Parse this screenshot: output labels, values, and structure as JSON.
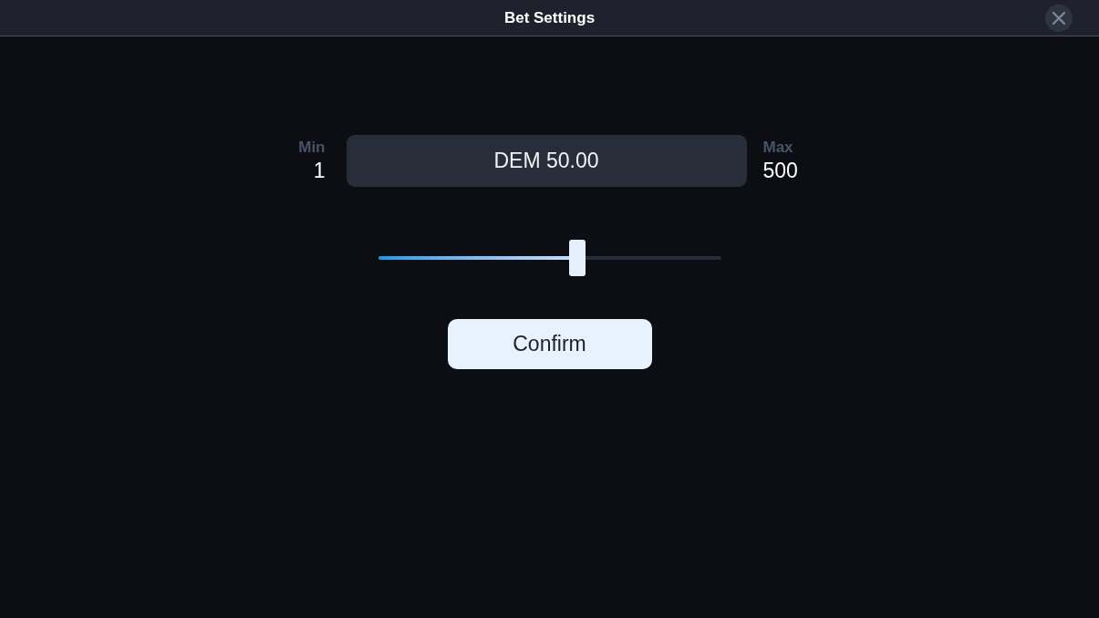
{
  "window": {
    "title": "Bet Settings"
  },
  "bet": {
    "min_label": "Min",
    "min_value": "1",
    "amount": "DEM 50.00",
    "max_label": "Max",
    "max_value": "500"
  },
  "slider": {
    "level": 0.58
  },
  "buttons": [
    {
      "label": "Confirm"
    }
  ]
}
